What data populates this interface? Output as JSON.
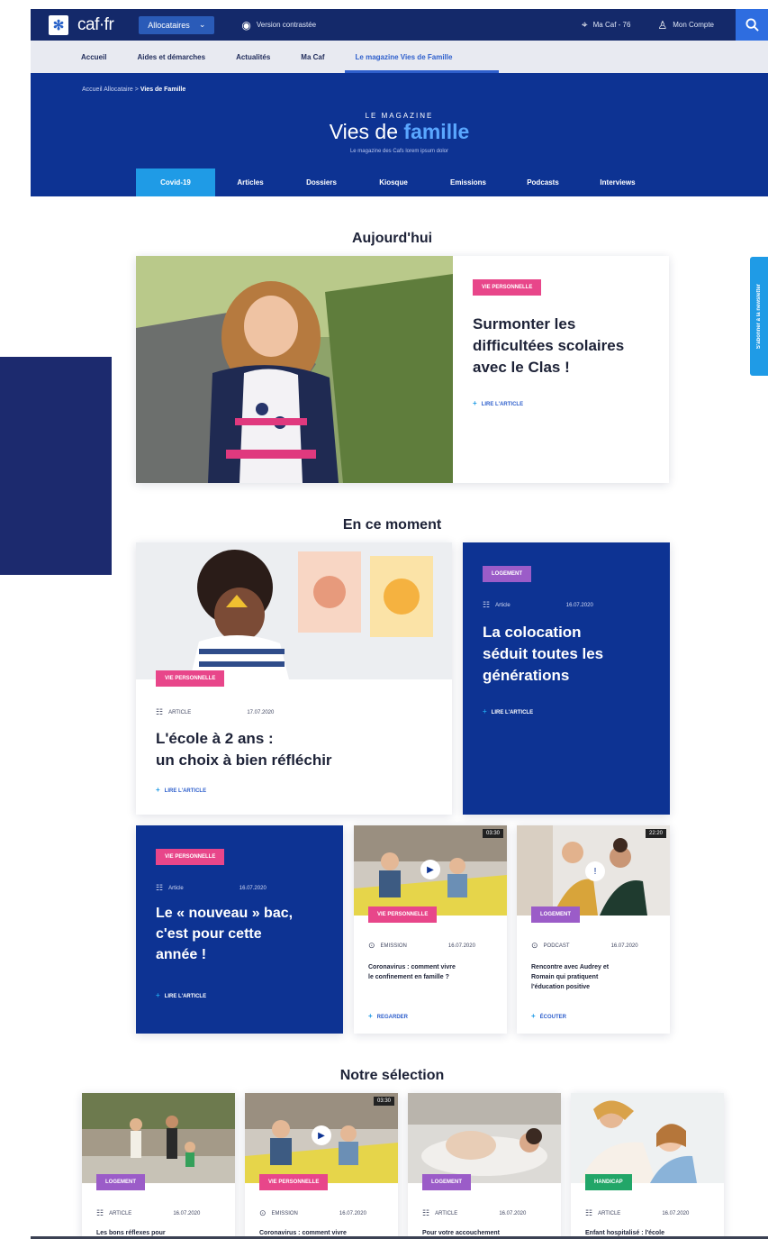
{
  "topbar": {
    "logo_text": "caf·fr",
    "allocataires_label": "Allocataires",
    "contrast_label": "Version contrastée",
    "macaf_label": "Ma Caf - 76",
    "compte_label": "Mon Compte"
  },
  "subnav": {
    "items": [
      {
        "label": "Accueil"
      },
      {
        "label": "Aides et démarches"
      },
      {
        "label": "Actualités"
      },
      {
        "label": "Ma Caf"
      },
      {
        "label": "Le magazine Vies de Famille"
      }
    ]
  },
  "hero": {
    "breadcrumb_parent": "Accueil Allocataire",
    "breadcrumb_sep": ">",
    "breadcrumb_current": "Vies de Famille",
    "kicker": "LE MAGAZINE",
    "title_part1": "Vies de",
    "title_part2": "famille",
    "subtitle": "Le magazine des Cafs lorem ipsum dolor",
    "tabs": [
      {
        "label": "Covid-19"
      },
      {
        "label": "Articles"
      },
      {
        "label": "Dossiers"
      },
      {
        "label": "Kiosque"
      },
      {
        "label": "Emissions"
      },
      {
        "label": "Podcasts"
      },
      {
        "label": "Interviews"
      }
    ]
  },
  "newsletter": {
    "label": "S'abonner à la newsletter"
  },
  "sections": {
    "today": "Aujourd'hui",
    "now": "En ce moment",
    "selection": "Notre sélection"
  },
  "featured": {
    "tag": "VIE PERSONNELLE",
    "title_lines": [
      "Surmonter les",
      "difficultées scolaires",
      "avec le Clas !"
    ],
    "cta": "LIRE L'ARTICLE"
  },
  "moment": {
    "ecole": {
      "tag": "VIE PERSONNELLE",
      "type": "ARTICLE",
      "date": "17.07.2020",
      "title_lines": [
        "L'école à 2 ans :",
        "un choix à bien réfléchir"
      ],
      "cta": "LIRE L'ARTICLE"
    },
    "coloc": {
      "tag": "LOGEMENT",
      "type": "Article",
      "date": "16.07.2020",
      "title_lines": [
        "La colocation",
        "séduit toutes les",
        "générations"
      ],
      "cta": "LIRE L'ARTICLE"
    },
    "bac": {
      "tag": "VIE PERSONNELLE",
      "type": "Article",
      "date": "16.07.2020",
      "title_lines": [
        "Le « nouveau » bac,",
        "c'est pour cette",
        "année !"
      ],
      "cta": "LIRE L'ARTICLE"
    },
    "emission": {
      "tag": "VIE PERSONNELLE",
      "duration": "03:30",
      "type": "EMISSION",
      "date": "16.07.2020",
      "title_lines": [
        "Coronavirus : comment vivre",
        "le confinement en famille ?"
      ],
      "cta": "REGARDER"
    },
    "podcast": {
      "tag": "LOGEMENT",
      "duration": "22:20",
      "type": "PODCAST",
      "date": "16.07.2020",
      "title_lines": [
        "Rencontre avec Audrey et",
        "Romain qui pratiquent",
        "l'éducation positive"
      ],
      "cta": "ÉCOUTER"
    }
  },
  "selection": [
    {
      "tag": "LOGEMENT",
      "type": "ARTICLE",
      "date": "16.07.2020",
      "title": "Les bons réflexes pour"
    },
    {
      "tag": "VIE PERSONNELLE",
      "duration": "03:30",
      "type": "EMISSION",
      "date": "16.07.2020",
      "title": "Coronavirus : comment vivre"
    },
    {
      "tag": "LOGEMENT",
      "type": "ARTICLE",
      "date": "16.07.2020",
      "title": "Pour votre accouchement"
    },
    {
      "tag": "HANDICAP",
      "type": "ARTICLE",
      "date": "16.07.2020",
      "title": "Enfant hospitalisé : l'école"
    }
  ],
  "colors": {
    "navy": "#14296a",
    "hero_blue": "#0d3393",
    "accent_cyan": "#1f9be6",
    "tag_pink": "#e8468a",
    "tag_purple": "#9b5cc8",
    "tag_green": "#22a668"
  },
  "icons": {
    "logo": "caf-logo-icon",
    "contrast": "eye-icon",
    "location": "map-pin-icon",
    "account": "user-icon",
    "search": "search-icon",
    "article": "article-icon",
    "emission": "play-circle-icon",
    "podcast": "play-circle-icon"
  }
}
